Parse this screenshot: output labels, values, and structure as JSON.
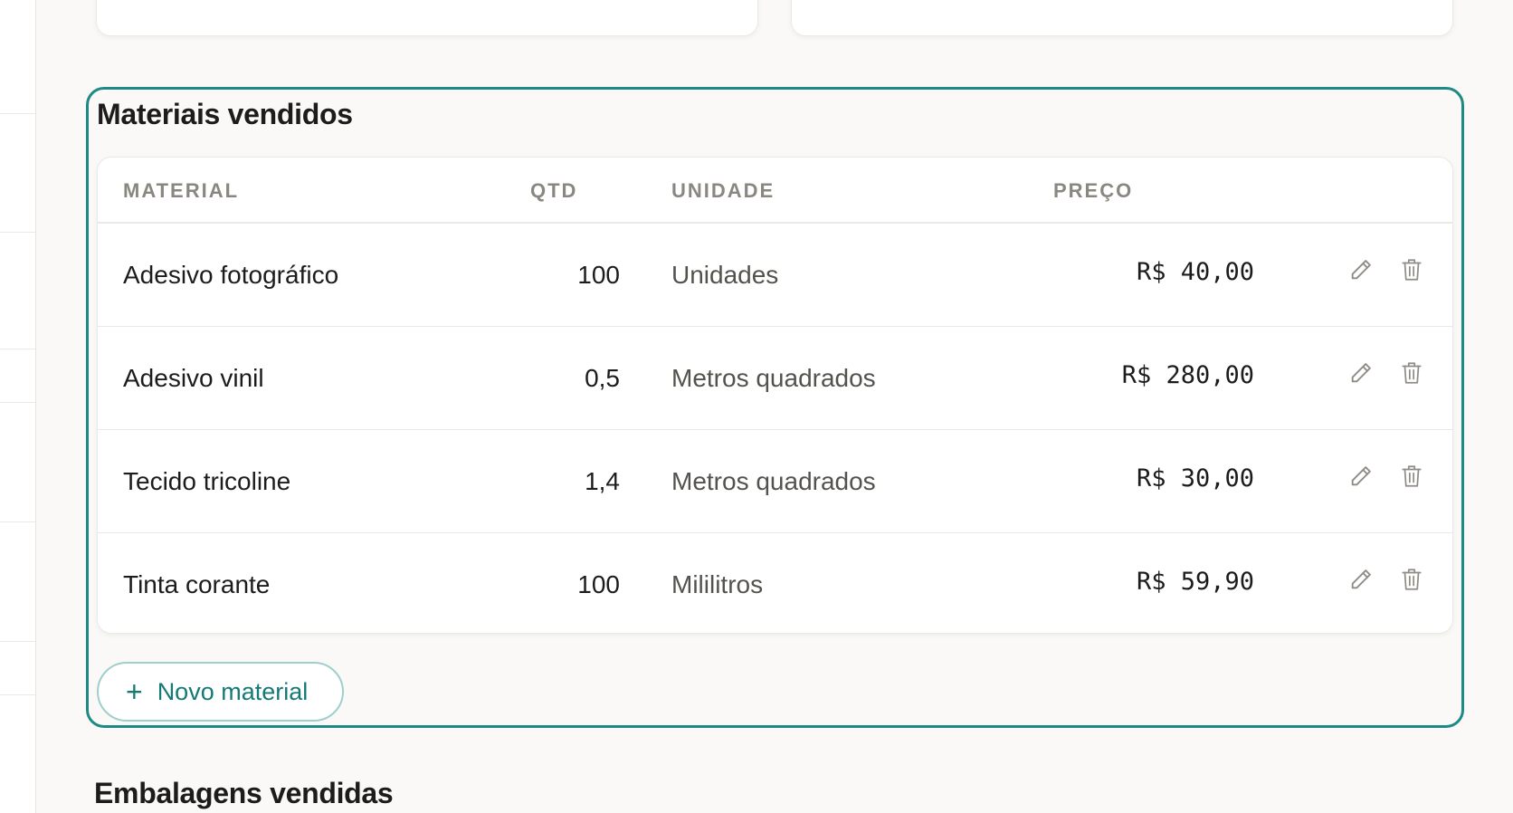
{
  "section": {
    "title": "Materiais vendidos",
    "columns": {
      "material": "MATERIAL",
      "qtd": "QTD",
      "unidade": "UNIDADE",
      "preco": "PREÇO"
    },
    "rows": [
      {
        "material": "Adesivo fotográfico",
        "qtd": "100",
        "unidade": "Unidades",
        "preco": "R$ 40,00"
      },
      {
        "material": "Adesivo vinil",
        "qtd": "0,5",
        "unidade": "Metros quadrados",
        "preco": "R$ 280,00"
      },
      {
        "material": "Tecido tricoline",
        "qtd": "1,4",
        "unidade": "Metros quadrados",
        "preco": "R$ 30,00"
      },
      {
        "material": "Tinta corante",
        "qtd": "100",
        "unidade": "Mililitros",
        "preco": "R$ 59,90"
      }
    ],
    "add_button_label": "Novo material",
    "add_button_icon": "plus-icon"
  },
  "next_section": {
    "title": "Embalagens vendidas"
  },
  "colors": {
    "accent": "#1e8a86",
    "accent_text": "#137a76",
    "border": "#ebe9e5"
  },
  "icons": {
    "edit": "pencil-icon",
    "delete": "trash-icon"
  }
}
